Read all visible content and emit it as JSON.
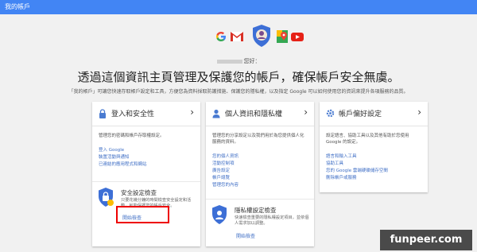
{
  "topbar": {
    "title": "我的帳戶"
  },
  "greeting": {
    "suffix": "您好："
  },
  "headline": "透過這個資訊主頁管理及保護您的帳戶，確保帳戶安全無虞。",
  "subtext": "「我的帳戶」可讓您快速存取帳戶設定和工具，方便您為資料採取防護措施、保護您的隱私權，以及指定 Google 可以如何使用您的資訊來提升各項服務的品質。",
  "cards": [
    {
      "title": "登入和安全性",
      "desc": "管理您的密碼和帳戶存取權設定。",
      "links": [
        "登入 Google",
        "裝置活動與通知",
        "已連結的應用程式和網站"
      ],
      "checkup": {
        "title": "安全設定檢查",
        "desc": "只要花幾分鐘的時間檢查安全設定和活動，就能保護您的帳戶安全。",
        "link": "開始檢查"
      }
    },
    {
      "title": "個人資訊和隱私權",
      "desc": "管理您的分享設定以及我們用於為您提供個人化服務的資料。",
      "links": [
        "您的個人資訊",
        "活動控制項",
        "廣告設定",
        "帳戶總覽",
        "管理您的內容"
      ],
      "checkup": {
        "title": "隱私權設定檢查",
        "desc": "快速檢查重要的隱私權設定項目，並依個人需求加以調整。",
        "link": "開始檢查"
      }
    },
    {
      "title": "帳戶偏好設定",
      "desc": "設定語言、協助工具以及其他有助於您使用 Google 的設定。",
      "links": [
        "語言和輸入工具",
        "協助工具",
        "您的 Google 雲端硬碟儲存空間",
        "刪除帳戶或服務"
      ]
    }
  ],
  "watermark": "funpeer.com",
  "colors": {
    "topbar": "#4285f4",
    "link": "#4170c6",
    "highlight": "#e00000"
  }
}
